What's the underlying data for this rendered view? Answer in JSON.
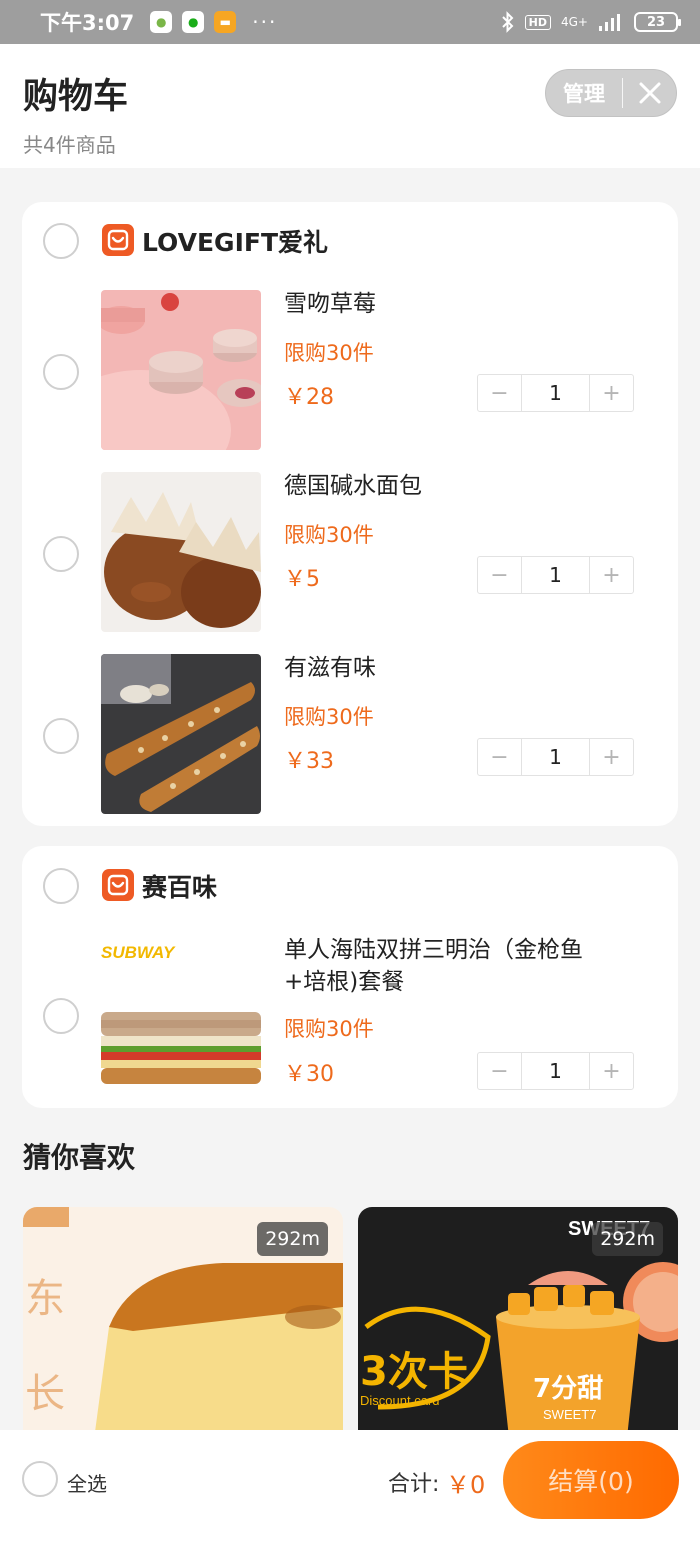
{
  "status_bar": {
    "time": "下午3:07",
    "dots": "···",
    "network": "4G+"
  },
  "header": {
    "title": "购物车",
    "subtitle": "共4件商品",
    "manage_label": "管理"
  },
  "stores": [
    {
      "name": "LOVEGIFT爱礼",
      "items": [
        {
          "name": "雪吻草莓",
          "limit": "限购30件",
          "price": "￥28",
          "qty": "1"
        },
        {
          "name": "德国碱水面包",
          "limit": "限购30件",
          "price": "￥5",
          "qty": "1"
        },
        {
          "name": "有滋有味",
          "limit": "限购30件",
          "price": "￥33",
          "qty": "1"
        }
      ]
    },
    {
      "name": "赛百味",
      "items": [
        {
          "name_line1": "单人海陆双拼三明治（金枪鱼",
          "name_line2": "+培根)套餐",
          "limit": "限购30件",
          "price": "￥30",
          "qty": "1",
          "brand": "SUBWAY"
        }
      ]
    }
  ],
  "recommend": {
    "title": "猜你喜欢",
    "items": [
      {
        "distance": "292m"
      },
      {
        "distance": "292m",
        "brand_text": "SWEET7",
        "promo": "3次卡",
        "promo_sub": "Discount card",
        "cup_text": "7分甜",
        "cup_sub": "SWEET7"
      }
    ]
  },
  "bottom_bar": {
    "select_all": "全选",
    "total_label": "合计:",
    "total_value": "￥0",
    "checkout_label": "结算(0)"
  },
  "colors": {
    "accent": "#ee6a1c",
    "checkout_gradient_start": "#ff8a1a",
    "checkout_gradient_end": "#ff6a00",
    "store_logo": "#ee5a24"
  }
}
